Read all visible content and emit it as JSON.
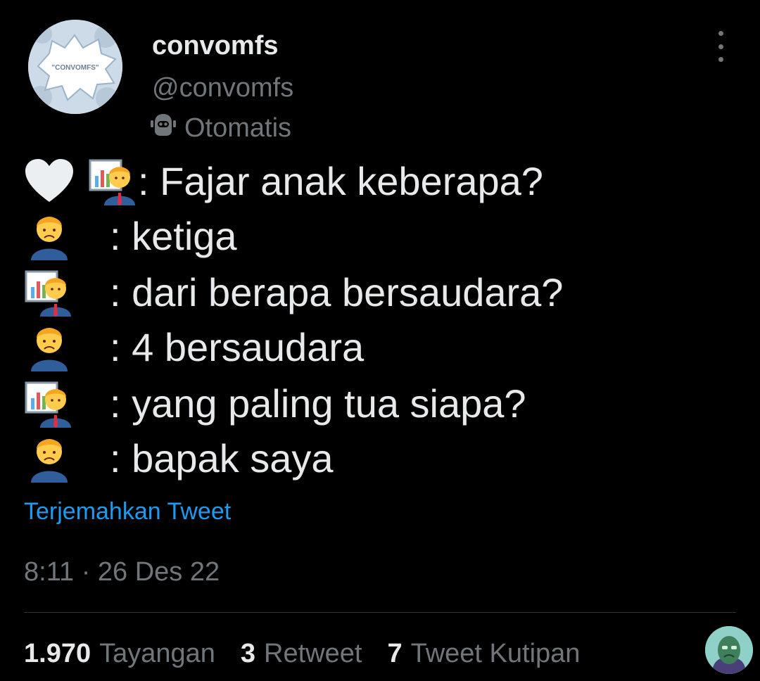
{
  "account": {
    "display_name": "convomfs",
    "handle": "@convomfs",
    "automated_label": "Otomatis",
    "avatar_text": "\"CONVOMFS\""
  },
  "tweet": {
    "lines": [
      {
        "speakers": [
          "white-heart",
          "man-teacher"
        ],
        "text": ": Fajar anak keberapa?"
      },
      {
        "speakers": [
          "man-frowning"
        ],
        "text": ": ketiga"
      },
      {
        "speakers": [
          "man-teacher"
        ],
        "text": ": dari berapa bersaudara?"
      },
      {
        "speakers": [
          "man-frowning"
        ],
        "text": ": 4 bersaudara"
      },
      {
        "speakers": [
          "man-teacher"
        ],
        "text": ": yang paling tua siapa?"
      },
      {
        "speakers": [
          "man-frowning"
        ],
        "text": ": bapak saya"
      }
    ],
    "translate_label": "Terjemahkan Tweet",
    "timestamp": "8:11 · 26 Des 22"
  },
  "stats": {
    "views_count": "1.970",
    "views_label": "Tayangan",
    "retweets_count": "3",
    "retweets_label": "Retweet",
    "quotes_count": "7",
    "quotes_label": "Tweet Kutipan"
  },
  "colors": {
    "background": "#000000",
    "text_primary": "#e7e9ea",
    "text_secondary": "#71767b",
    "link": "#1d9bf0",
    "divider": "#2f3336"
  }
}
